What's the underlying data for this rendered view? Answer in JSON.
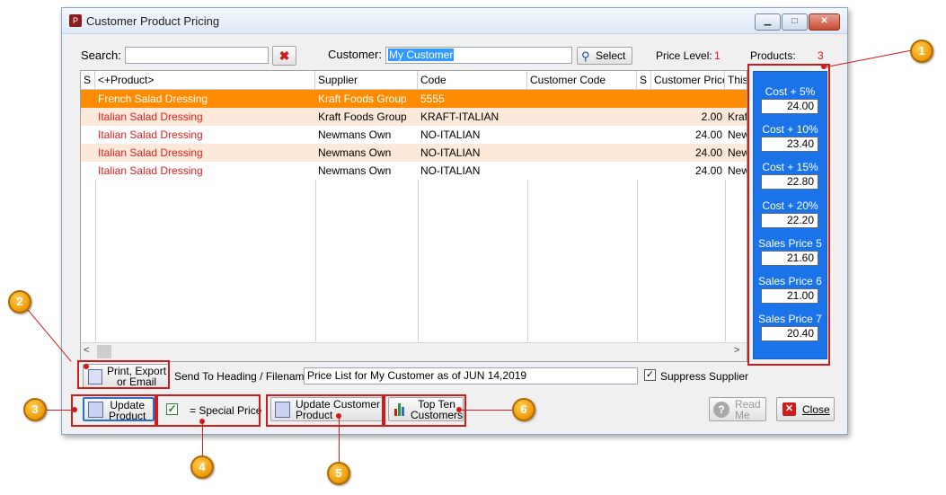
{
  "window": {
    "title": "Customer Product Pricing",
    "icon_text": "P"
  },
  "search": {
    "label": "Search:",
    "value": ""
  },
  "customer": {
    "label": "Customer:",
    "value": "My Customer",
    "select_label": "Select"
  },
  "price_level": {
    "label": "Price Level:",
    "value": "1"
  },
  "products": {
    "label": "Products:",
    "value": "3"
  },
  "grid": {
    "columns": [
      "S",
      "<+Product>",
      "Supplier",
      "Code",
      "Customer Code",
      "S",
      "Customer Price",
      "This"
    ],
    "rows": [
      {
        "product": "French Salad Dressing",
        "supplier": "Kraft Foods Group",
        "code": "5555",
        "customer_code": "",
        "price": "",
        "this": ""
      },
      {
        "product": "Italian Salad Dressing",
        "supplier": "Kraft Foods Group",
        "code": "KRAFT-ITALIAN",
        "customer_code": "",
        "price": "2.00",
        "this": "Kraf"
      },
      {
        "product": "Italian Salad Dressing",
        "supplier": "Newmans Own",
        "code": "NO-ITALIAN",
        "customer_code": "",
        "price": "24.00",
        "this": "New"
      },
      {
        "product": "Italian Salad Dressing",
        "supplier": "Newmans Own",
        "code": "NO-ITALIAN",
        "customer_code": "",
        "price": "24.00",
        "this": "New"
      },
      {
        "product": "Italian Salad Dressing",
        "supplier": "Newmans Own",
        "code": "NO-ITALIAN",
        "customer_code": "",
        "price": "24.00",
        "this": "New"
      }
    ]
  },
  "price_panel": [
    {
      "label": "Cost + 5%",
      "value": "24.00"
    },
    {
      "label": "Cost + 10%",
      "value": "23.40"
    },
    {
      "label": "Cost + 15%",
      "value": "22.80"
    },
    {
      "label": "Cost + 20%",
      "value": "22.20"
    },
    {
      "label": "Sales Price 5",
      "value": "21.60"
    },
    {
      "label": "Sales Price 6",
      "value": "21.00"
    },
    {
      "label": "Sales Price 7",
      "value": "20.40"
    }
  ],
  "print": {
    "label_line1": "Print, Export",
    "label_line2": "or Email"
  },
  "send_to": {
    "label": "Send To Heading / Filename:",
    "value": "Price List for My Customer as of JUN 14,2019"
  },
  "suppress": {
    "label": "Suppress Supplier",
    "checked": true
  },
  "buttons": {
    "update_product_1": "Update",
    "update_product_2": "Product",
    "special_price": "= Special Price",
    "update_customer_1": "Update Customer",
    "update_customer_2": "Product",
    "top_ten_1": "Top Ten",
    "top_ten_2": "Customers",
    "read_me_1": "Read",
    "read_me_2": "Me",
    "close": "Close"
  },
  "callouts": [
    "1",
    "2",
    "3",
    "4",
    "5",
    "6"
  ],
  "colors": {
    "selected_row": "#ff8c00",
    "alt_row": "#fde9d9",
    "red_text": "#e02020",
    "price_panel": "#1a73e8",
    "annotation": "#d11a1a"
  }
}
